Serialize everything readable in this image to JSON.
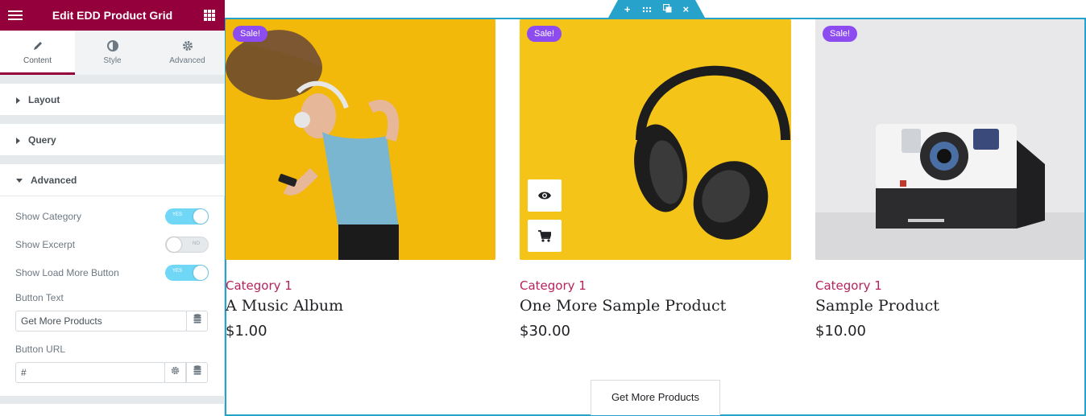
{
  "sidebar": {
    "title": "Edit EDD Product Grid",
    "tabs": [
      {
        "label": "Content",
        "icon": "pencil-icon"
      },
      {
        "label": "Style",
        "icon": "half-circle-icon"
      },
      {
        "label": "Advanced",
        "icon": "gear-icon"
      }
    ],
    "sections": {
      "layout": "Layout",
      "query": "Query",
      "advanced": "Advanced"
    },
    "controls": {
      "show_category": {
        "label": "Show Category",
        "state": "YES"
      },
      "show_excerpt": {
        "label": "Show Excerpt",
        "state": "NO"
      },
      "show_load_more": {
        "label": "Show Load More Button",
        "state": "YES"
      },
      "button_text": {
        "label": "Button Text",
        "value": "Get More Products"
      },
      "button_url": {
        "label": "Button URL",
        "value": "#"
      }
    }
  },
  "products": [
    {
      "badge": "Sale!",
      "category": "Category 1",
      "title": "A Music Album",
      "price": "$1.00"
    },
    {
      "badge": "Sale!",
      "category": "Category 1",
      "title": "One More Sample Product",
      "price": "$30.00"
    },
    {
      "badge": "Sale!",
      "category": "Category 1",
      "title": "Sample Product",
      "price": "$10.00"
    }
  ],
  "load_more_label": "Get More Products",
  "colors": {
    "header": "#93003c",
    "accent": "#26a2cb",
    "sale_badge": "#8c4cf0",
    "category": "#b6235c"
  }
}
